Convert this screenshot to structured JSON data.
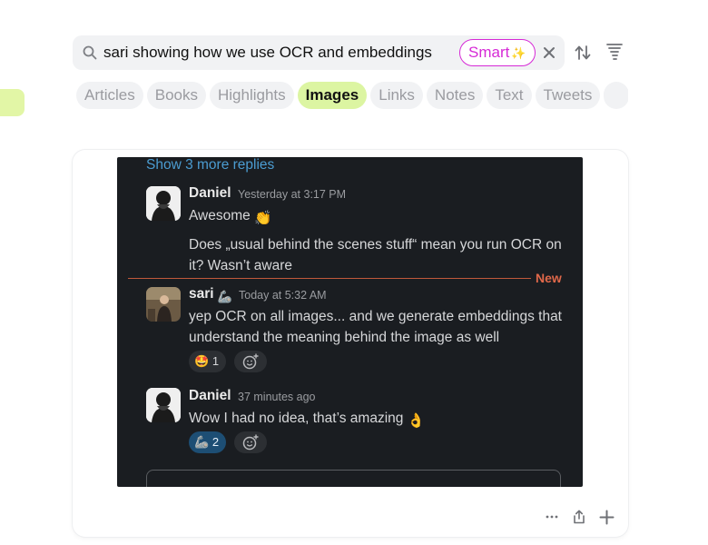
{
  "search": {
    "query": "sari showing how we use OCR and embeddings",
    "smart_label": "Smart",
    "smart_icon": "sparkles-icon"
  },
  "tabs": [
    {
      "label": "Articles",
      "active": false
    },
    {
      "label": "Books",
      "active": false
    },
    {
      "label": "Highlights",
      "active": false
    },
    {
      "label": "Images",
      "active": true
    },
    {
      "label": "Links",
      "active": false
    },
    {
      "label": "Notes",
      "active": false
    },
    {
      "label": "Text",
      "active": false
    },
    {
      "label": "Tweets",
      "active": false
    }
  ],
  "colors": {
    "accent_smart": "#d62ad6",
    "active_tab": "#dcf5a2",
    "slack_bg": "#1a1d21",
    "new_divider": "#e0684a",
    "link": "#4b9cd1"
  },
  "image": {
    "more_replies": "Show 3 more replies",
    "new_label": "New",
    "messages": [
      {
        "name": "Daniel",
        "time": "Yesterday at 3:17 PM",
        "lines": [
          "Awesome",
          "Does „usual behind the scenes stuff“ mean you run OCR on it? Wasn’t aware"
        ],
        "emoji": "👏"
      },
      {
        "name": "sari",
        "name_emoji": "🦾",
        "time": "Today at 5:32 AM",
        "lines": [
          "yep OCR on all images... and we generate embeddings that understand the meaning behind the image as well"
        ],
        "reaction": {
          "emoji": "🤩",
          "count": "1"
        }
      },
      {
        "name": "Daniel",
        "time": "37 minutes ago",
        "lines": [
          "Wow I had no idea, that’s amazing"
        ],
        "emoji": "👌",
        "reaction": {
          "emoji": "🦾",
          "count": "2"
        }
      }
    ]
  },
  "card_actions": [
    "more-icon",
    "share-icon",
    "plus-icon"
  ]
}
